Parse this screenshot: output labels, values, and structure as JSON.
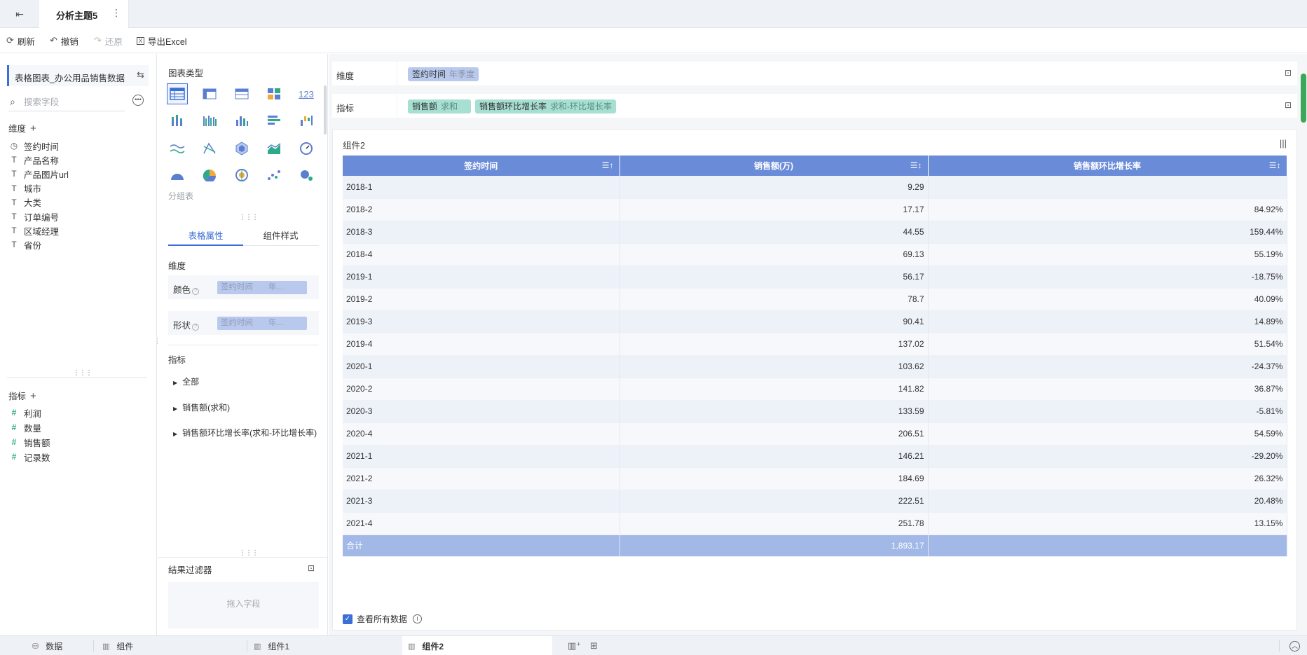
{
  "topbar": {
    "tab_title": "分析主题5",
    "more": "⋮"
  },
  "toolbar": {
    "refresh": "刷新",
    "undo": "撤销",
    "redo": "还原",
    "export": "导出Excel"
  },
  "left_panel": {
    "dataset_name": "表格图表_办公用品销售数据",
    "search_placeholder": "搜索字段",
    "dimension_label": "维度",
    "dimensions": [
      {
        "icon": "clock-icon",
        "name": "签约时间"
      },
      {
        "icon": "text-icon",
        "name": "产品名称"
      },
      {
        "icon": "text-icon",
        "name": "产品图片url"
      },
      {
        "icon": "text-icon",
        "name": "城市"
      },
      {
        "icon": "text-icon",
        "name": "大类"
      },
      {
        "icon": "text-icon",
        "name": "订单编号"
      },
      {
        "icon": "text-icon",
        "name": "区域经理"
      },
      {
        "icon": "text-icon",
        "name": "省份"
      }
    ],
    "measure_label": "指标",
    "measures": [
      {
        "icon": "hash-icon",
        "name": "利润"
      },
      {
        "icon": "hash-icon",
        "name": "数量"
      },
      {
        "icon": "hash-icon",
        "name": "销售额"
      },
      {
        "icon": "hash-icon",
        "name": "记录数"
      }
    ]
  },
  "mid_panel": {
    "chart_type_label": "图表类型",
    "chart_hint": "分组表",
    "tabs": [
      "表格属性",
      "组件样式"
    ],
    "dimension_label": "维度",
    "color_label": "颜色",
    "shape_label": "形状",
    "pill_field": "签约时间",
    "pill_sub": "年...",
    "measure_label": "指标",
    "tree": [
      "全部",
      "销售额(求和)",
      "销售额环比增长率(求和-环比增长率)"
    ],
    "filter_title": "结果过滤器",
    "filter_drop": "拖入字段"
  },
  "shelves": {
    "dimension_label": "维度",
    "dimension_chip": {
      "name": "签约时间",
      "sub": "年季度"
    },
    "measure_label": "指标",
    "measure_chips": [
      {
        "name": "销售额",
        "sub": "求和"
      },
      {
        "name": "销售额环比增长率",
        "sub": "求和-环比增长率"
      }
    ]
  },
  "component": {
    "title": "组件2",
    "columns": [
      "签约时间",
      "销售额(万)",
      "销售额环比增长率"
    ],
    "rows": [
      [
        "2018-1",
        "9.29",
        ""
      ],
      [
        "2018-2",
        "17.17",
        "84.92%"
      ],
      [
        "2018-3",
        "44.55",
        "159.44%"
      ],
      [
        "2018-4",
        "69.13",
        "55.19%"
      ],
      [
        "2019-1",
        "56.17",
        "-18.75%"
      ],
      [
        "2019-2",
        "78.7",
        "40.09%"
      ],
      [
        "2019-3",
        "90.41",
        "14.89%"
      ],
      [
        "2019-4",
        "137.02",
        "51.54%"
      ],
      [
        "2020-1",
        "103.62",
        "-24.37%"
      ],
      [
        "2020-2",
        "141.82",
        "36.87%"
      ],
      [
        "2020-3",
        "133.59",
        "-5.81%"
      ],
      [
        "2020-4",
        "206.51",
        "54.59%"
      ],
      [
        "2021-1",
        "146.21",
        "-29.20%"
      ],
      [
        "2021-2",
        "184.69",
        "26.32%"
      ],
      [
        "2021-3",
        "222.51",
        "20.48%"
      ],
      [
        "2021-4",
        "251.78",
        "13.15%"
      ]
    ],
    "total": [
      "合计",
      "1,893.17",
      ""
    ],
    "view_all": "查看所有数据"
  },
  "bottom_tabs": [
    "数据",
    "组件",
    "组件1",
    "组件2"
  ],
  "colors": {
    "accent": "#3b6fd6",
    "header": "#6a8bd8",
    "total": "#a2b8e6",
    "measure_chip": "#a7e0d3",
    "dimension_chip": "#b9c9ed"
  }
}
